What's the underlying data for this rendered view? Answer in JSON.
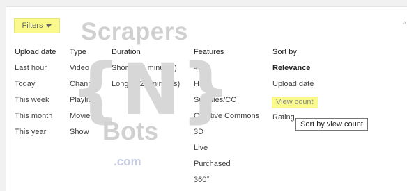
{
  "filters_button": {
    "label": "Filters",
    "icon": "caret-down-icon"
  },
  "columns": [
    {
      "name": "upload-date",
      "header": "Upload date",
      "items": [
        "Last hour",
        "Today",
        "This week",
        "This month",
        "This year"
      ]
    },
    {
      "name": "type",
      "header": "Type",
      "items": [
        "Video",
        "Channel",
        "Playlist",
        "Movie",
        "Show"
      ]
    },
    {
      "name": "duration",
      "header": "Duration",
      "items": [
        "Short (< 4 minutes)",
        "Long (> 20 minutes)"
      ]
    },
    {
      "name": "features",
      "header": "Features",
      "items": [
        "4K",
        "HD",
        "Subtitles/CC",
        "Creative Commons",
        "3D",
        "Live",
        "Purchased",
        "360°"
      ]
    },
    {
      "name": "sort-by",
      "header": "Sort by",
      "items": [
        "Relevance",
        "Upload date",
        "View count",
        "Rating"
      ],
      "active": "Relevance",
      "highlighted": "View count"
    }
  ],
  "tooltip": "Sort by view count",
  "watermark": {
    "top": "Scrapers",
    "middle": "{N}",
    "bottom": "Bots",
    "domain": ".com"
  },
  "colors": {
    "highlight": "#fafa8c",
    "panel": "#ffffff",
    "background": "#f1f1f1"
  }
}
